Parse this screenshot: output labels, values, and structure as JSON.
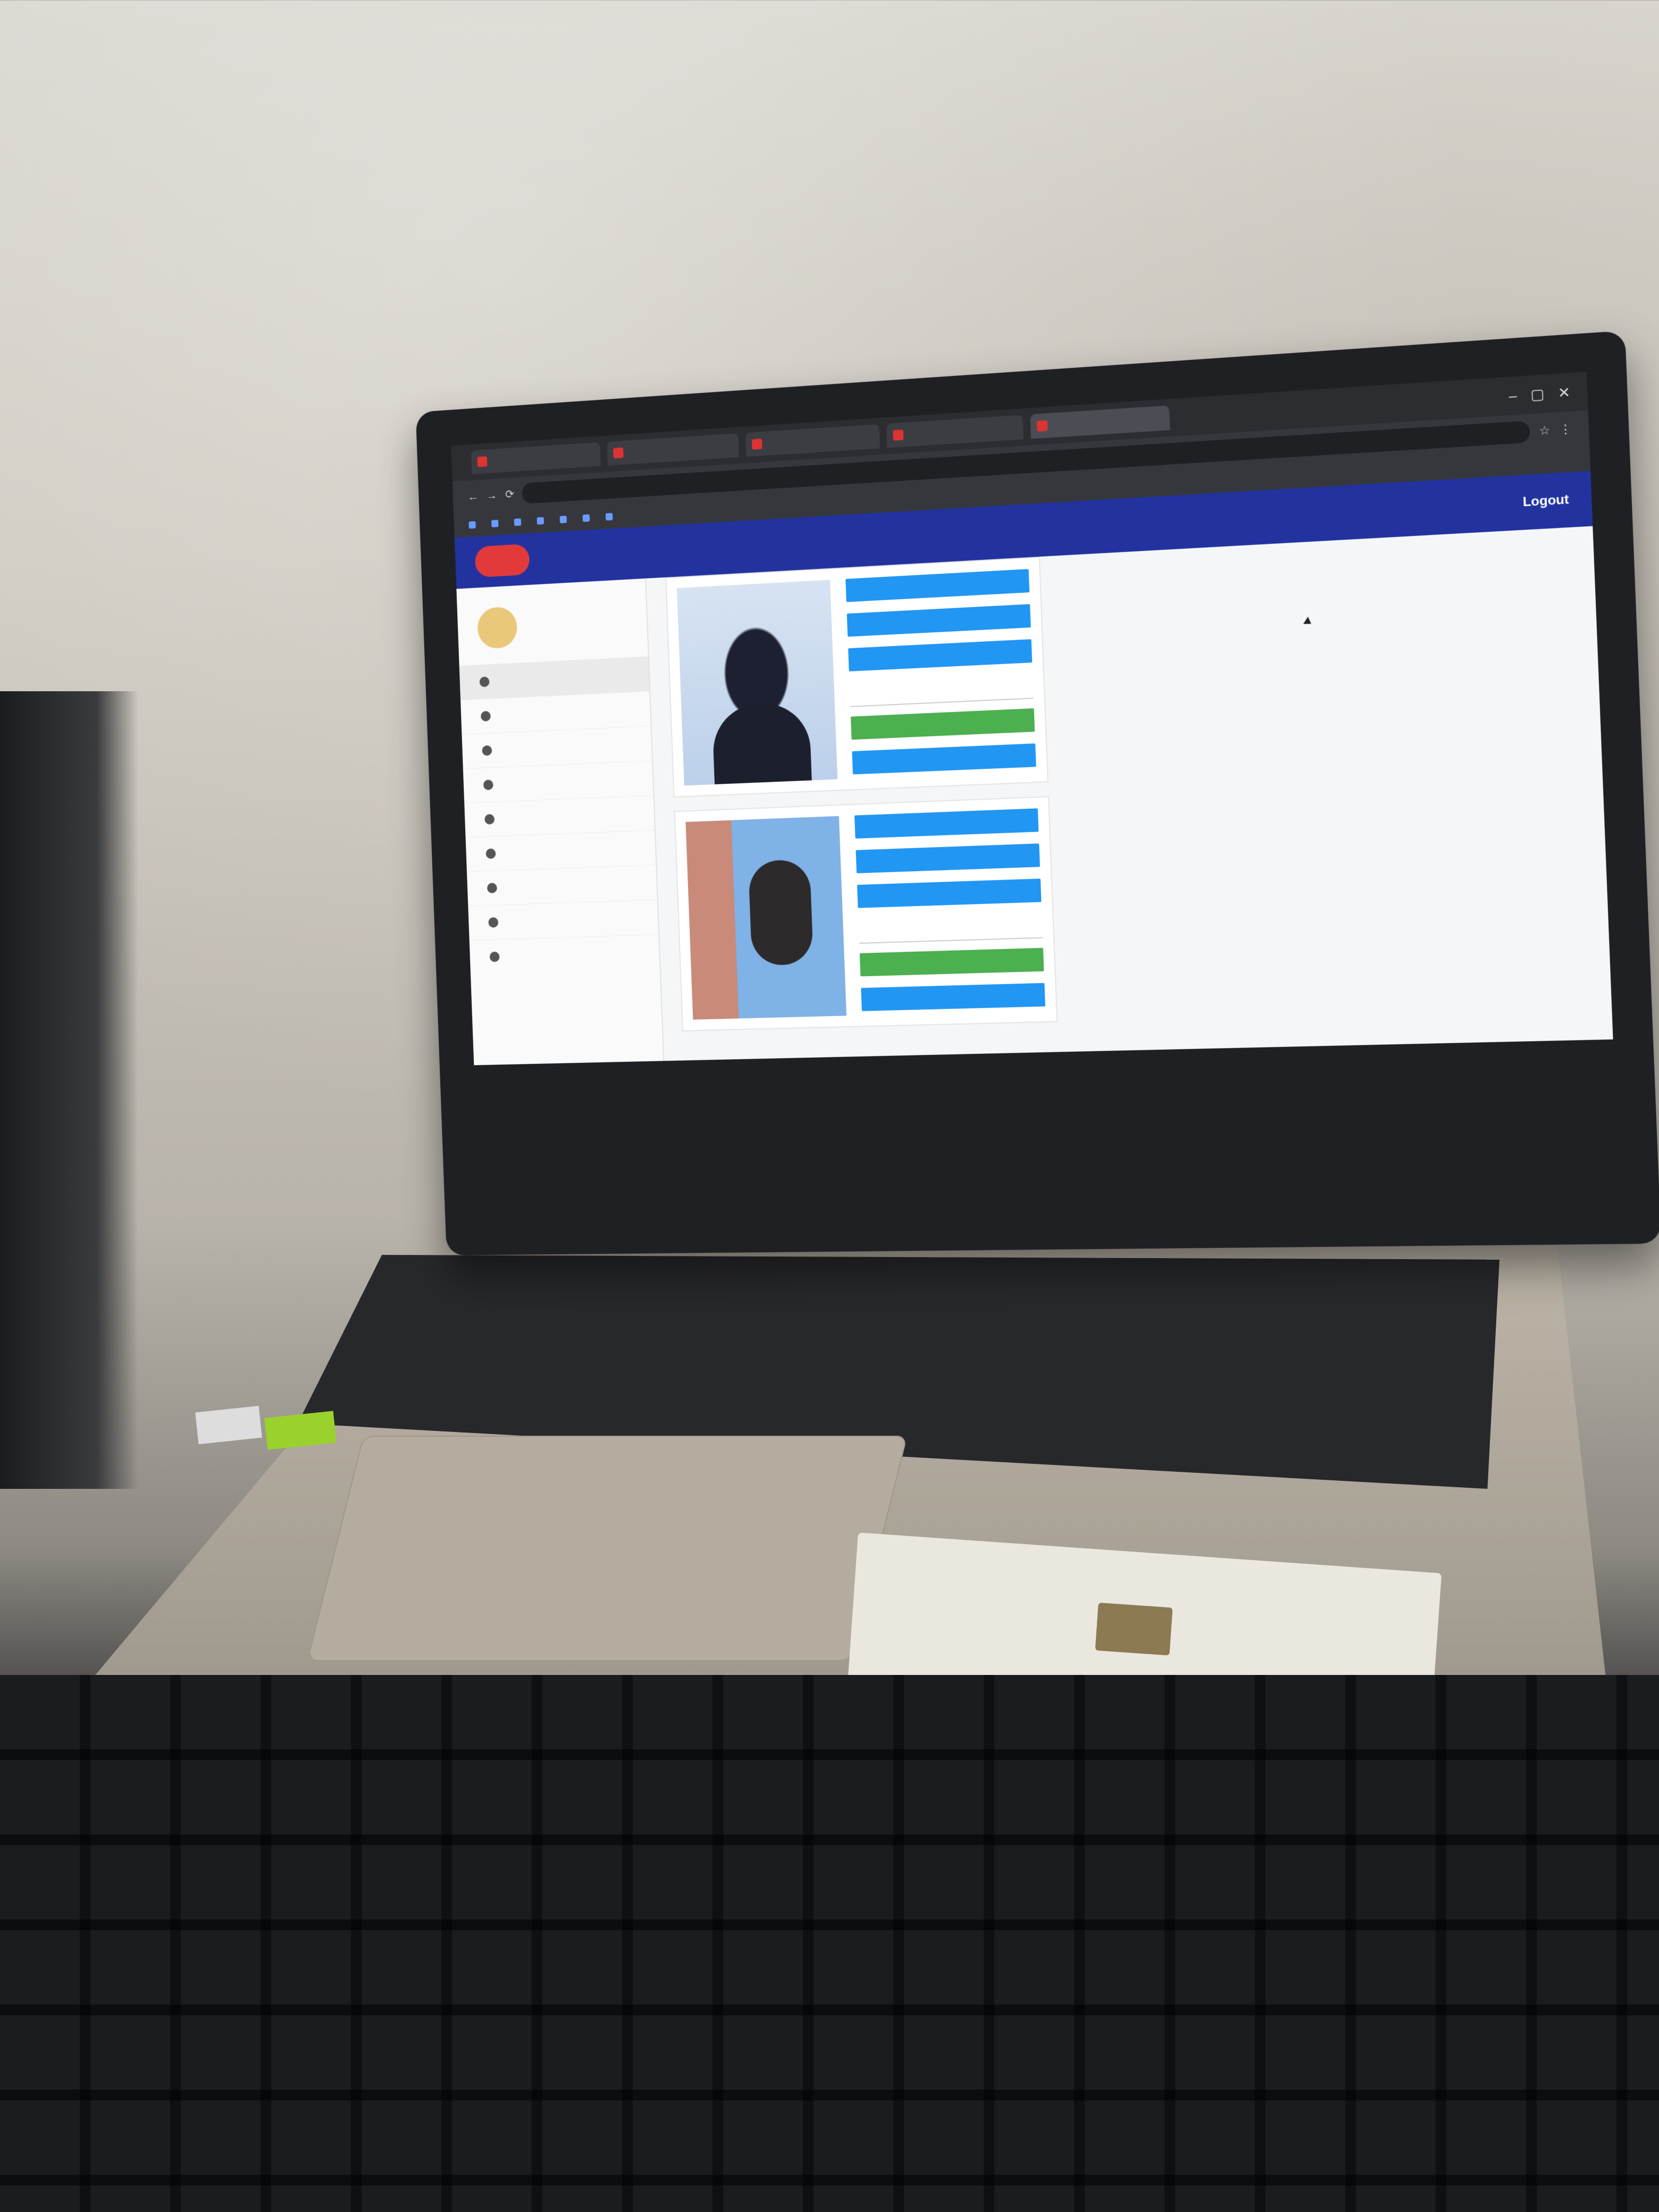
{
  "browser": {
    "tabs": [
      {
        "label": ""
      },
      {
        "label": ""
      },
      {
        "label": ""
      },
      {
        "label": ""
      },
      {
        "label": ""
      }
    ],
    "url": "",
    "bookmarks": [
      "",
      "",
      "",
      "",
      "",
      "",
      ""
    ]
  },
  "app": {
    "logo": "",
    "logout_label": "Logout",
    "menu": [
      {
        "label": "",
        "icon": "user-icon"
      },
      {
        "label": "",
        "icon": "image-icon"
      },
      {
        "label": "",
        "icon": "list-icon"
      },
      {
        "label": "",
        "icon": "tag-icon"
      },
      {
        "label": "",
        "icon": "tag-icon"
      },
      {
        "label": "",
        "icon": "settings-icon"
      },
      {
        "label": "",
        "icon": "settings-icon"
      },
      {
        "label": "",
        "icon": "settings-icon"
      },
      {
        "label": "",
        "icon": "settings-icon"
      }
    ],
    "cards": [
      {
        "buttons": [
          "",
          "",
          ""
        ],
        "select": "",
        "green_button": "",
        "blue_bottom": "",
        "note": ""
      },
      {
        "buttons": [
          "",
          "",
          ""
        ],
        "select": "",
        "green_button": "",
        "blue_bottom": "",
        "note": ""
      }
    ]
  },
  "colors": {
    "appbar": "#2233a0",
    "button_blue": "#2196f3",
    "button_green": "#4caf50",
    "logo_red": "#e23a3a"
  }
}
